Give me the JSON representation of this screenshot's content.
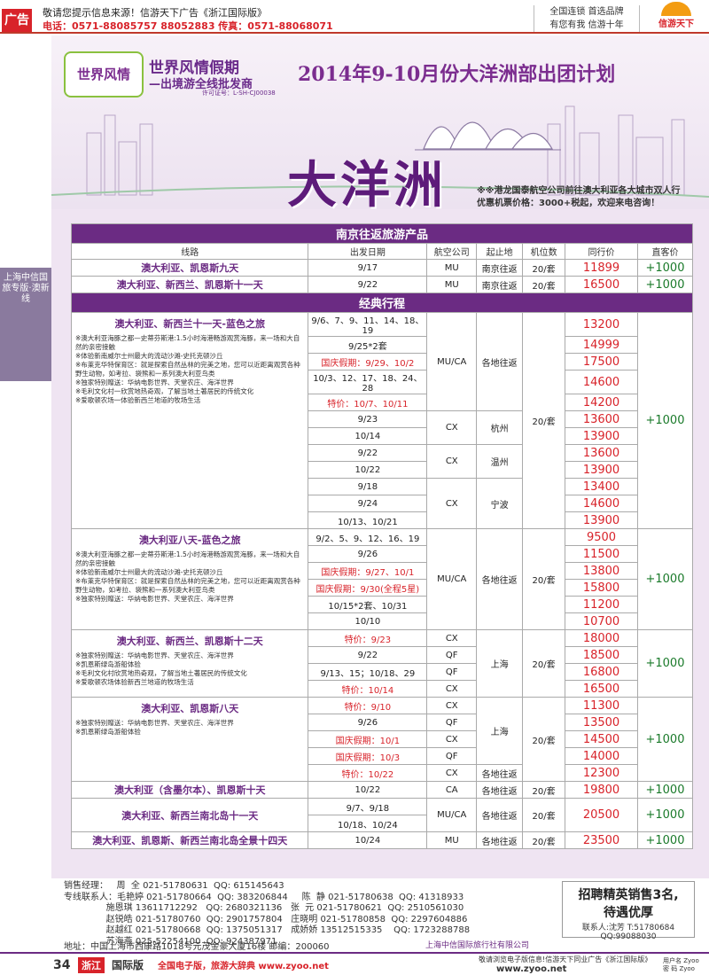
{
  "top": {
    "ad_tag": "广告",
    "notice": "敬请您提示信息来源！信游天下广告《浙江国际版》",
    "tel": "电话：0571-88085757 88052883 传真：0571-88068071",
    "right1": "全国连锁  首选品牌",
    "right2": "有您有我  信游十年",
    "logo": "信游天下"
  },
  "banner": {
    "brand_logo": "世界风情",
    "brand_title": "世界风情假期",
    "brand_sub": "—出境游全线批发商",
    "license": "许可证号：L-SH-CJ00038",
    "main_title": "2014年9-10月份大洋洲部出团计划",
    "big_title": "大洋洲",
    "promo1": "※※港龙国泰航空公司前往澳大利亚各大城市双人行",
    "promo2": "优惠机票价格：3000+税起，欢迎来电咨询！"
  },
  "sidebar": "上海中信国旅专版·澳新线",
  "table": {
    "sec1": "南京往返旅游产品",
    "headers": [
      "线路",
      "出发日期",
      "航空公司",
      "起止地",
      "机位数",
      "同行价",
      "直客价"
    ],
    "sec2": "经典行程",
    "nj": [
      {
        "route": "澳大利亚、凯恩斯九天",
        "date": "9/17",
        "air": "MU",
        "from": "南京往返",
        "seats": "20/套",
        "price": "11899",
        "add": "+1000"
      },
      {
        "route": "澳大利亚、新西兰、凯恩斯十一天",
        "date": "9/22",
        "air": "MU",
        "from": "南京往返",
        "seats": "20/套",
        "price": "16500",
        "add": "+1000"
      }
    ],
    "g1": {
      "route": "澳大利亚、新西兰十一天-蓝色之旅",
      "notes": [
        "※澳大利亚海豚之都—史蒂芬斯港:1.5小时海港畅游观赏海豚，来一场和大自然的亲密接触",
        "※体验新南威尔士州最大的流动沙滩-史托克顿沙丘",
        "※布莱克华特保育区：就是探索自然丛林的完美之地，您可以近距离观赏各种野生动物，如考拉、袋熊和一系列澳大利亚鸟类",
        "※独家特别赠送：华纳电影世界、天堂农庄、海洋世界",
        "※毛利文化村一欣赏地热奇观，了解当地土著居民的传统文化",
        "※爱歌顿农场一体验新西兰地道的牧场生活"
      ],
      "rows": [
        {
          "date": "9/6、7、9、11、14、18、19",
          "price": "13200",
          "hl": false
        },
        {
          "date": "9/25*2套",
          "price": "14999",
          "hl": false
        },
        {
          "date": "国庆假期：9/29、10/2",
          "price": "17500",
          "hl": true
        },
        {
          "date": "10/3、12、17、18、24、28",
          "price": "14600",
          "hl": false
        },
        {
          "date": "特价：10/7、10/11",
          "price": "14200",
          "hl": true
        },
        {
          "date": "9/23",
          "price": "13600",
          "hl": false
        },
        {
          "date": "10/14",
          "price": "13900",
          "hl": false
        },
        {
          "date": "9/22",
          "price": "13600",
          "hl": false
        },
        {
          "date": "10/22",
          "price": "13900",
          "hl": false
        },
        {
          "date": "9/18",
          "price": "13400",
          "hl": false
        },
        {
          "date": "9/24",
          "price": "14600",
          "hl": false
        },
        {
          "date": "10/13、10/21",
          "price": "13900",
          "hl": false
        }
      ],
      "airs": [
        "MU/CA",
        "CX",
        "CX",
        "CX"
      ],
      "froms": [
        "各地往返",
        "杭州",
        "温州",
        "宁波"
      ],
      "seats": "20/套",
      "add": "+1000"
    },
    "g2": {
      "route": "澳大利亚八天-蓝色之旅",
      "notes": [
        "※澳大利亚海豚之都—史蒂芬斯港:1.5小时海港畅游观赏海豚，来一场和大自然的亲密接触",
        "※体验新南威尔士州最大的流动沙滩-史托克顿沙丘",
        "※布莱克华特保育区：就是探索自然丛林的完美之地，您可以近距离观赏各种野生动物，如考拉、袋熊和一系列澳大利亚鸟类",
        "※独家特别赠送：华纳电影世界、天堂农庄、海洋世界"
      ],
      "rows": [
        {
          "date": "9/2、5、9、12、16、19",
          "price": "9500",
          "hl": false
        },
        {
          "date": "9/26",
          "price": "11500",
          "hl": false
        },
        {
          "date": "国庆假期：9/27、10/1",
          "price": "13800",
          "hl": true
        },
        {
          "date": "国庆假期：9/30(全程5星)",
          "price": "15800",
          "hl": true
        },
        {
          "date": "10/15*2套、10/31",
          "price": "11200",
          "hl": false
        },
        {
          "date": "10/10",
          "price": "10700",
          "hl": false
        }
      ],
      "air": "MU/CA",
      "from": "各地往返",
      "seats": "20/套",
      "add": "+1000"
    },
    "g3": {
      "route": "澳大利亚、新西兰、凯恩斯十二天",
      "notes": [
        "※独家特别赠送：华纳电影世界、天堂农庄、海洋世界",
        "※凯恩斯绿岛游船体验",
        "※毛利文化村欣赏地热奇观，了解当地土著居民的传统文化",
        "※爱歌顿农场体验新西兰地道的牧场生活"
      ],
      "rows": [
        {
          "date": "特价：9/23",
          "air": "CX",
          "price": "18000",
          "hl": true
        },
        {
          "date": "9/22",
          "air": "QF",
          "price": "18500",
          "hl": false
        },
        {
          "date": "9/13、15；10/18、29",
          "air": "QF",
          "price": "16800",
          "hl": false
        },
        {
          "date": "特价：10/14",
          "air": "CX",
          "price": "16500",
          "hl": true
        }
      ],
      "from": "上海",
      "seats": "20/套",
      "add": "+1000"
    },
    "g4": {
      "route": "澳大利亚、凯恩斯八天",
      "notes": [
        "※独家特别赠送：华纳电影世界、天堂农庄、海洋世界",
        "※凯恩斯绿岛游船体验"
      ],
      "rows": [
        {
          "date": "特价：9/10",
          "air": "CX",
          "price": "11300",
          "hl": true
        },
        {
          "date": "9/26",
          "air": "QF",
          "price": "13500",
          "hl": false
        },
        {
          "date": "国庆假期：10/1",
          "air": "CX",
          "price": "14500",
          "hl": true
        },
        {
          "date": "国庆假期：10/3",
          "air": "QF",
          "price": "14000",
          "hl": true
        },
        {
          "date": "特价：10/22",
          "air": "CX",
          "price": "12300",
          "hl": true
        }
      ],
      "from": "上海",
      "from_last": "各地往返",
      "seats": "20/套",
      "add": "+1000"
    },
    "g5": {
      "route": "澳大利亚（含墨尔本）、凯恩斯十天",
      "date": "10/22",
      "air": "CA",
      "from": "各地往返",
      "seats": "20/套",
      "price": "19800",
      "add": "+1000"
    },
    "g6": {
      "route": "澳大利亚、新西兰南北岛十一天",
      "dates": [
        "9/7、9/18",
        "10/18、10/24"
      ],
      "air": "MU/CA",
      "from": "各地往返",
      "seats": "20/套",
      "price": "20500",
      "add": "+1000"
    },
    "g7": {
      "route": "澳大利亚、凯恩斯、新西兰南北岛全景十四天",
      "date": "10/24",
      "air": "MU",
      "from": "各地往返",
      "seats": "20/套",
      "price": "23500",
      "add": "+1000"
    }
  },
  "contacts": {
    "rows": [
      "销售经理：   周  全 021-51780631  QQ: 615145643",
      "专线联系人：毛艳婷 021-51780664  QQ: 383206844     陈  静 021-51780638  QQ: 41318933",
      "               施恩琪 13611712292   QQ: 2680321136   张  元 021-51780621  QQ: 2510561030",
      "               赵锐皓 021-51780760  QQ: 2901757804   庄晓明 021-51780858  QQ: 2297604886",
      "               赵越红 021-51780668  QQ: 1375051317   成娇娇 13512515335    QQ: 1723288788",
      "               苏海燕 025-52254100  QQ: 924387971"
    ],
    "address": "地址：中国上海市西康路1018号元茂金豪大厦16楼  邮编：200060",
    "company": "上海中信国际旅行社有限公司"
  },
  "recruit": {
    "t1": "招聘精英销售3名,",
    "t2": "待遇优厚",
    "c1": "联系人:沈芳  T:51780684",
    "c2": "QQ:99088030"
  },
  "footer": {
    "page": "34",
    "zj": "浙江",
    "intl": "国际版",
    "slogan": "全国电子版，旅游大辞典 www.zyoo.net",
    "right": "敬请浏览电子版信息!信游天下同业广告《浙江国际版》",
    "url": "www.zyoo.net",
    "login": "用户名 Zyoo\n密 码 Zyoo"
  }
}
